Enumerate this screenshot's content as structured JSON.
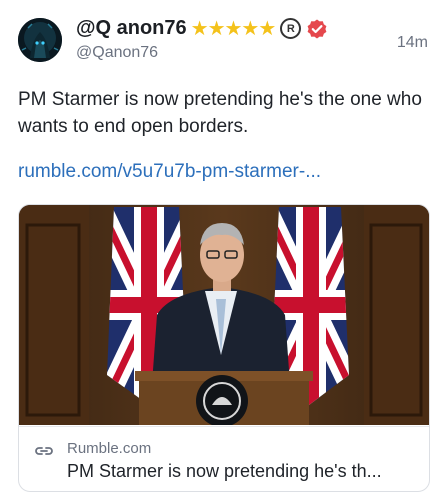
{
  "post": {
    "display_name": "@Q anon76",
    "badges": "★★★★★",
    "registered_mark": "R",
    "handle": "@Qanon76",
    "time": "14m",
    "text": "PM Starmer is now pretending he's the one who wants to end open borders.",
    "link": "rumble.com/v5u7u7b-pm-starmer-..."
  },
  "card": {
    "domain": "Rumble.com",
    "title": "PM Starmer is now pretending he's th..."
  },
  "colors": {
    "link": "#2c6fbb",
    "star": "#f4c21b",
    "verified": "#e5484d",
    "muted": "#6b7280"
  },
  "icons": {
    "verified": "verified-badge-icon",
    "registered": "registered-mark-icon",
    "link": "link-icon"
  }
}
